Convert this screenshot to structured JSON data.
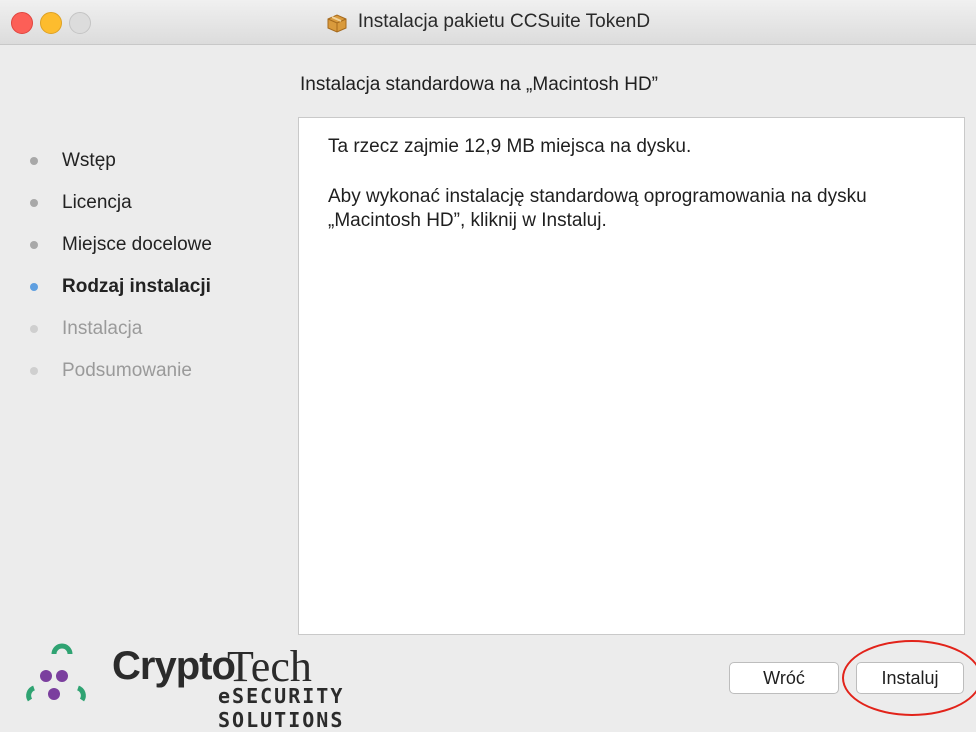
{
  "window": {
    "title": "Instalacja pakietu CCSuite TokenD"
  },
  "heading": "Instalacja standardowa na „Macintosh HD”",
  "steps": [
    {
      "label": "Wstęp",
      "state": "done"
    },
    {
      "label": "Licencja",
      "state": "done"
    },
    {
      "label": "Miejsce docelowe",
      "state": "done"
    },
    {
      "label": "Rodzaj instalacji",
      "state": "current"
    },
    {
      "label": "Instalacja",
      "state": "pending"
    },
    {
      "label": "Podsumowanie",
      "state": "pending"
    }
  ],
  "content": {
    "line1": "Ta rzecz zajmie 12,9 MB miejsca na dysku.",
    "line2": "Aby wykonać instalację standardową oprogramowania na dysku „Macintosh HD”, kliknij w Instaluj."
  },
  "logo": {
    "crypto": "Crypto",
    "tech": "Tech",
    "sub": "eSECURITY SOLUTIONS"
  },
  "buttons": {
    "back": "Wróć",
    "install": "Instaluj"
  },
  "colors": {
    "current_step_dot": "#5f9fe0",
    "annotation_ring": "#e2231a",
    "close": "#fc5f57",
    "minimize": "#fdbc2e"
  },
  "icons": {
    "package": "package-icon",
    "logo_mark": "cryptotech-logo-icon"
  }
}
